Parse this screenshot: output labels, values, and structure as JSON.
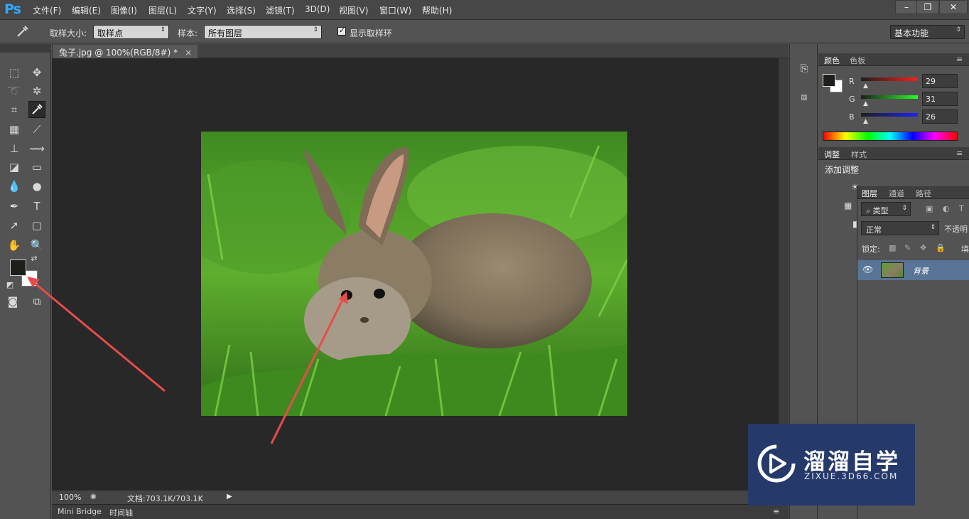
{
  "app": {
    "logo": "Ps"
  },
  "menu": [
    "文件(F)",
    "编辑(E)",
    "图像(I)",
    "图层(L)",
    "文字(Y)",
    "选择(S)",
    "滤镜(T)",
    "3D(D)",
    "视图(V)",
    "窗口(W)",
    "帮助(H)"
  ],
  "window_controls": {
    "minimize": "–",
    "restore": "❐",
    "close": "✕"
  },
  "options": {
    "sample_size_label": "取样大小:",
    "sample_size_value": "取样点",
    "sample_label": "样本:",
    "sample_value": "所有图层",
    "show_ring_label": "显示取样环",
    "show_ring_checked": true,
    "workspace": "基本功能"
  },
  "document": {
    "tab_title": "兔子.jpg @ 100%(RGB/8#) *",
    "close_glyph": "×",
    "zoom": "100%",
    "doc_info": "文档:703.1K/703.1K"
  },
  "bottom_tabs": [
    "Mini Bridge",
    "时间轴"
  ],
  "color_panel": {
    "tabs": [
      "颜色",
      "色板"
    ],
    "active_tab": "颜色",
    "r": {
      "label": "R",
      "value": "29"
    },
    "g": {
      "label": "G",
      "value": "31"
    },
    "b": {
      "label": "B",
      "value": "26"
    },
    "foreground": "#1d1f1a",
    "background": "#ffffff"
  },
  "adjust_panel": {
    "tabs": [
      "调整",
      "样式"
    ],
    "active_tab": "调整",
    "title": "添加调整"
  },
  "layers_panel": {
    "tabs": [
      "图层",
      "通道",
      "路径"
    ],
    "active_tab": "图层",
    "filter_label": "类型",
    "blend_mode": "正常",
    "opacity_label": "不透明",
    "lock_label": "锁定:",
    "fill_label": "填",
    "layers": [
      {
        "name": "背景",
        "visible": true
      }
    ]
  },
  "watermark": {
    "title": "溜溜自学",
    "subtitle": "ZIXUE.3D66.COM"
  },
  "tools": [
    "rect-marquee",
    "move",
    "lasso",
    "magic-wand",
    "crop",
    "eyedropper",
    "healing",
    "brush",
    "stamp",
    "history-brush",
    "eraser",
    "gradient",
    "blur",
    "dodge",
    "pen",
    "type",
    "path-select",
    "shape",
    "hand",
    "zoom"
  ],
  "active_tool": "eyedropper",
  "colors": {
    "annotation_arrow": "#e84b4b",
    "layer_selected": "#587496",
    "watermark_bg": "#253a6a"
  }
}
